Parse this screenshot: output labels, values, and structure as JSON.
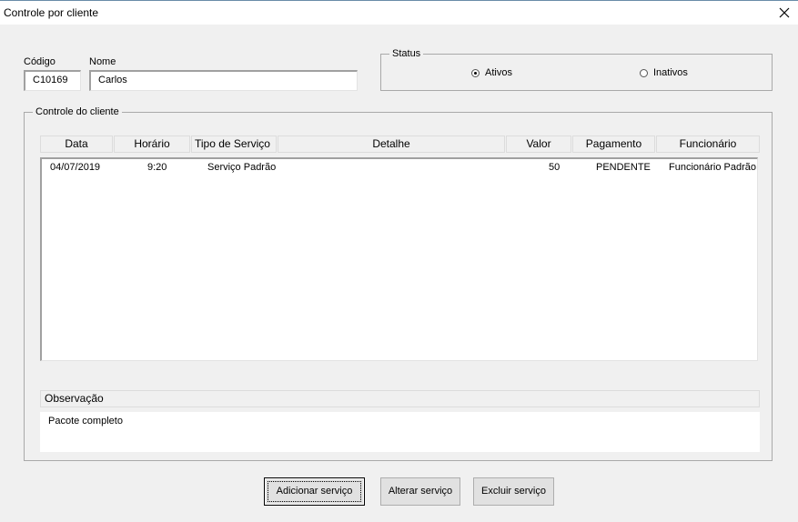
{
  "window": {
    "title": "Controle por cliente",
    "close_icon": "close-icon"
  },
  "client": {
    "codigo_label": "Código",
    "codigo_value": "C10169",
    "nome_label": "Nome",
    "nome_value": "Carlos"
  },
  "status": {
    "caption": "Status",
    "options": [
      {
        "label": "Ativos",
        "selected": true
      },
      {
        "label": "Inativos",
        "selected": false
      }
    ]
  },
  "controle": {
    "caption": "Controle do cliente",
    "columns": [
      "Data",
      "Horário",
      "Tipo de Serviço",
      "Detalhe",
      "Valor",
      "Pagamento",
      "Funcionário"
    ],
    "rows": [
      {
        "data": "04/07/2019",
        "horario": "9:20",
        "tipo": "Serviço Padrão",
        "detalhe": "",
        "valor": "50",
        "pagamento": "PENDENTE",
        "funcionario": "Funcionário Padrão"
      }
    ]
  },
  "observacao": {
    "header": "Observação",
    "text": "Pacote completo"
  },
  "buttons": {
    "adicionar": "Adicionar serviço",
    "alterar": "Alterar serviço",
    "excluir": "Excluir serviço"
  }
}
